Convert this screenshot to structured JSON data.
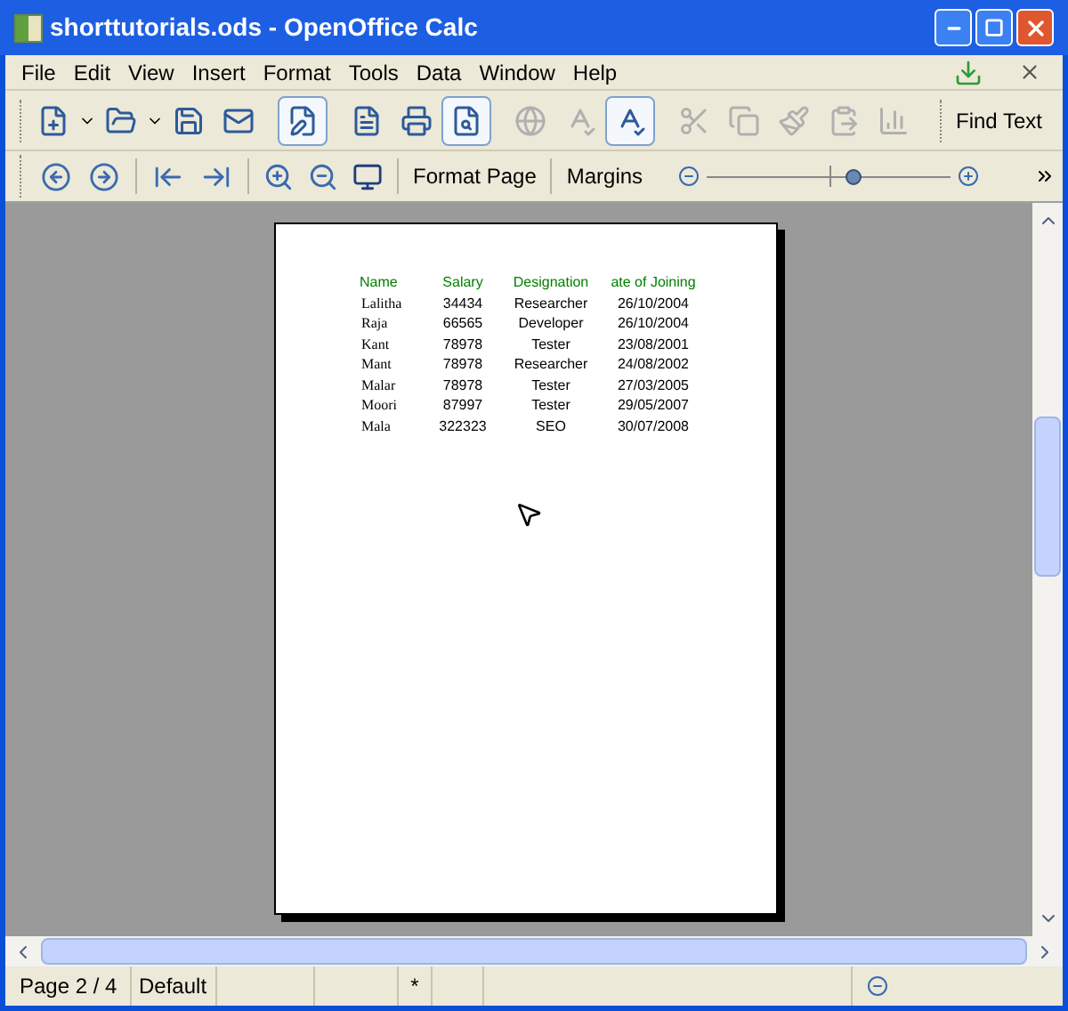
{
  "window": {
    "title": "shorttutorials.ods - OpenOffice Calc"
  },
  "menu": [
    "File",
    "Edit",
    "View",
    "Insert",
    "Format",
    "Tools",
    "Data",
    "Window",
    "Help"
  ],
  "standard_toolbar": [
    {
      "selected": false,
      "disabled": false
    },
    {
      "selected": false,
      "disabled": false
    },
    {
      "selected": false,
      "disabled": false
    },
    {
      "selected": false,
      "disabled": false
    },
    {
      "selected": true,
      "disabled": false
    },
    {
      "selected": false,
      "disabled": false
    },
    {
      "selected": false,
      "disabled": false
    },
    {
      "selected": true,
      "disabled": false
    },
    {
      "selected": false,
      "disabled": true
    },
    {
      "selected": false,
      "disabled": true
    },
    {
      "selected": true,
      "disabled": false
    },
    {
      "selected": false,
      "disabled": true
    },
    {
      "selected": false,
      "disabled": true
    },
    {
      "selected": false,
      "disabled": true
    },
    {
      "selected": false,
      "disabled": true
    },
    {
      "selected": false,
      "disabled": true
    }
  ],
  "find_toolbar": {
    "label": "Find Text"
  },
  "preview_toolbar": {
    "buttons": [
      "Format Page",
      "Margins"
    ],
    "zoom": {
      "level": 0.6
    }
  },
  "sheet": {
    "columns": [
      "Name",
      "Salary",
      "Designation",
      "ate of Joining"
    ],
    "rows": [
      [
        "Lalitha",
        "34434",
        "Researcher",
        "26/10/2004"
      ],
      [
        "Raja",
        "66565",
        "Developer",
        "26/10/2004"
      ],
      [
        "Kant",
        "78978",
        "Tester",
        "23/08/2001"
      ],
      [
        "Mant",
        "78978",
        "Researcher",
        "24/08/2002"
      ],
      [
        "Malar",
        "78978",
        "Tester",
        "27/03/2005"
      ],
      [
        "Moori",
        "87997",
        "Tester",
        "29/05/2007"
      ],
      [
        "Mala",
        "322323",
        "SEO",
        "30/07/2008"
      ]
    ]
  },
  "status_bar": [
    "Page 2 / 4",
    "Default",
    "*"
  ]
}
